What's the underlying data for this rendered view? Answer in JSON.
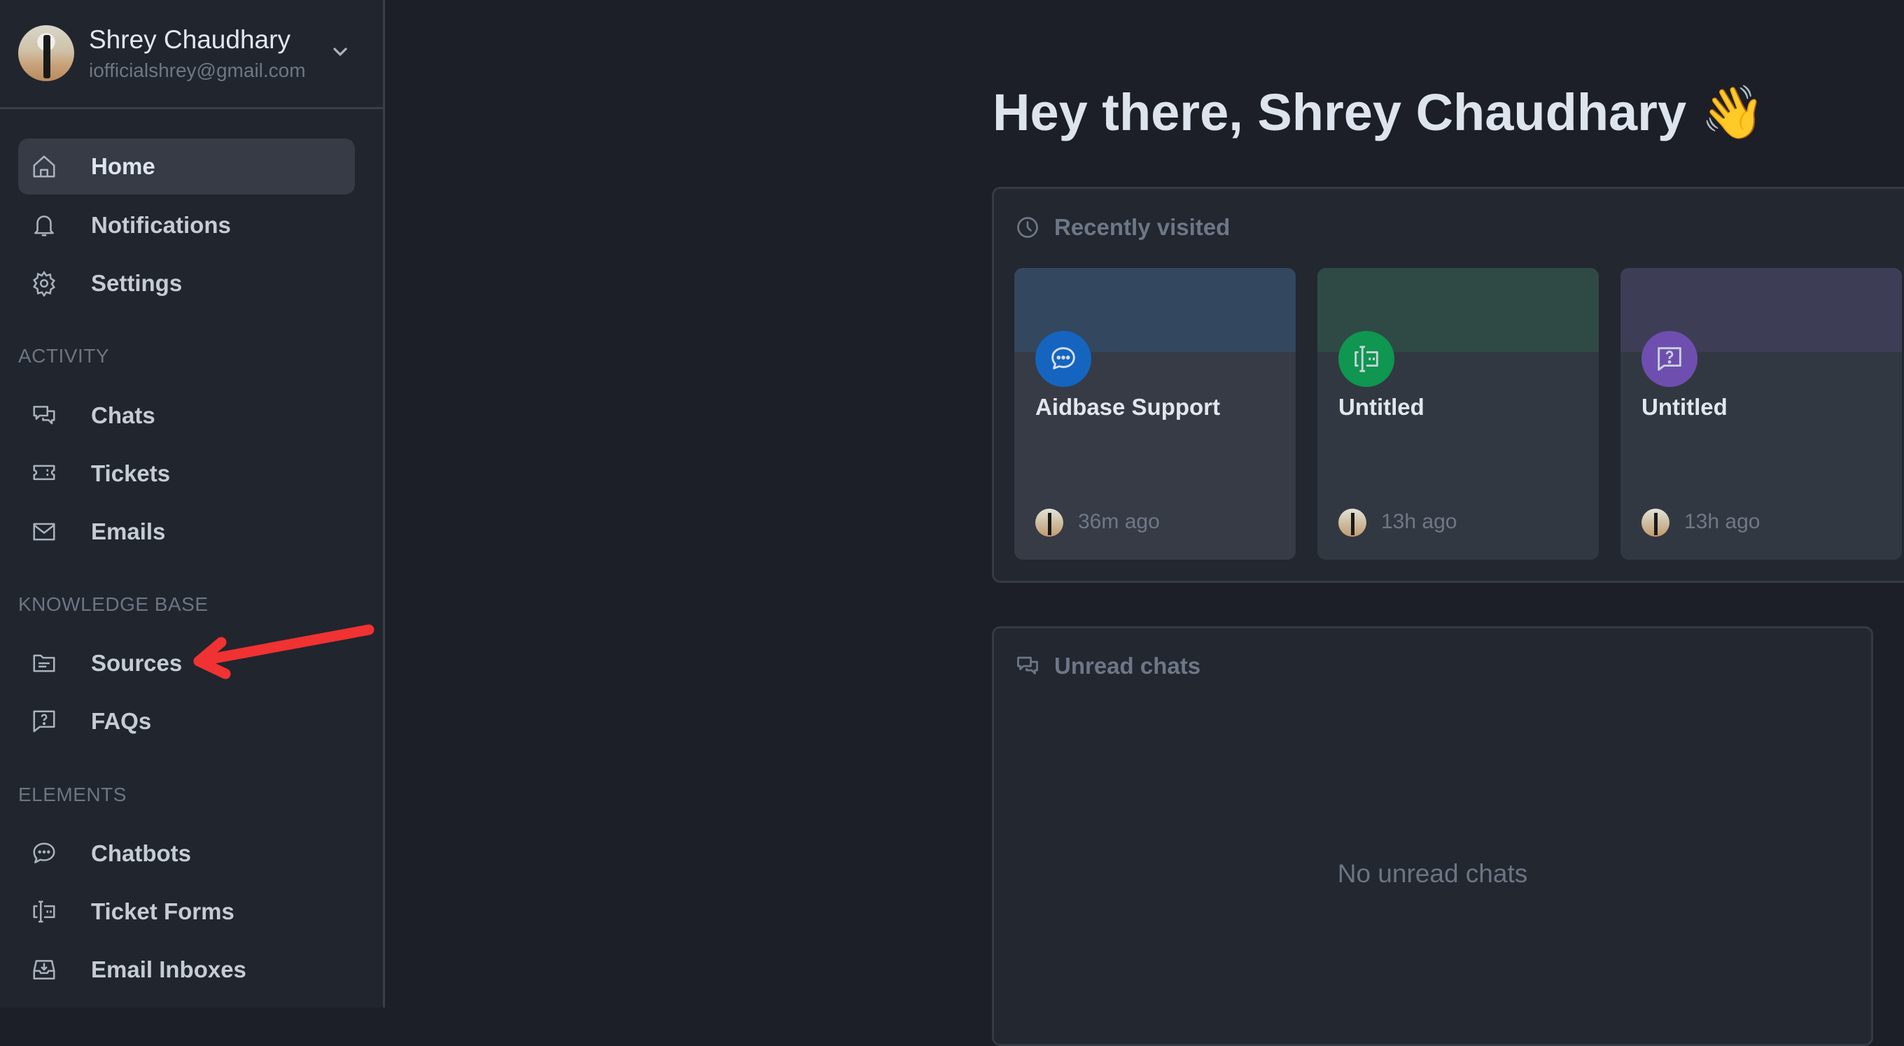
{
  "profile": {
    "name": "Shrey Chaudhary",
    "email": "iofficialshrey@gmail.com"
  },
  "sidebar": {
    "top_items": [
      {
        "label": "Home",
        "icon": "home-icon",
        "active": true
      },
      {
        "label": "Notifications",
        "icon": "bell-icon"
      },
      {
        "label": "Settings",
        "icon": "gear-icon"
      }
    ],
    "sections": [
      {
        "title": "ACTIVITY",
        "items": [
          {
            "label": "Chats",
            "icon": "chats-icon"
          },
          {
            "label": "Tickets",
            "icon": "ticket-icon"
          },
          {
            "label": "Emails",
            "icon": "mail-icon"
          }
        ]
      },
      {
        "title": "KNOWLEDGE BASE",
        "items": [
          {
            "label": "Sources",
            "icon": "folder-icon"
          },
          {
            "label": "FAQs",
            "icon": "faq-icon"
          }
        ]
      },
      {
        "title": "ELEMENTS",
        "items": [
          {
            "label": "Chatbots",
            "icon": "chatbot-icon"
          },
          {
            "label": "Ticket Forms",
            "icon": "ticket-form-icon"
          },
          {
            "label": "Email Inboxes",
            "icon": "inbox-icon"
          }
        ]
      }
    ]
  },
  "annotation": {
    "arrow_target": "Sources",
    "color": "#f03232"
  },
  "main": {
    "greeting": "Hey there, Shrey Chaudhary 👋",
    "recent": {
      "title": "Recently visited",
      "cards": [
        {
          "title": "Aidbase Support",
          "time": "36m ago",
          "icon": "chatbot-icon",
          "accent": "#1565c0",
          "band": "#33475f"
        },
        {
          "title": "Untitled",
          "time": "13h ago",
          "icon": "ticket-form-icon",
          "accent": "#0f9650",
          "band": "#2f4a45"
        },
        {
          "title": "Untitled",
          "time": "13h ago",
          "icon": "faq-icon",
          "accent": "#6e4fb0",
          "band": "#3d3e55"
        }
      ]
    },
    "unread": {
      "title": "Unread chats",
      "empty_text": "No unread chats"
    }
  }
}
